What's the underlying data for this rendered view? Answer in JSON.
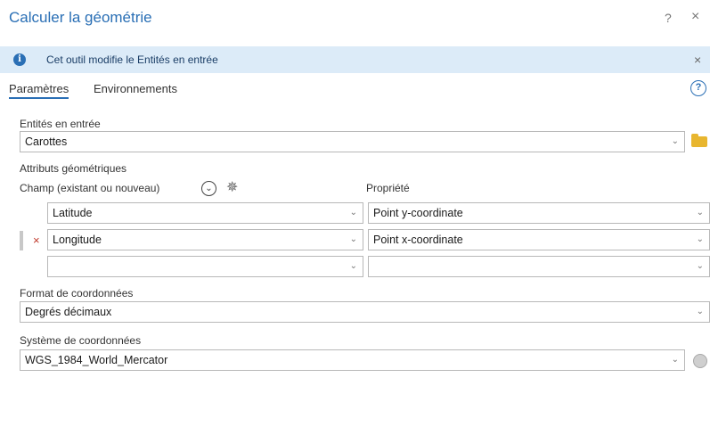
{
  "window": {
    "title": "Calculer la géométrie",
    "help_label": "?",
    "close_label": "×"
  },
  "info": {
    "icon": "info-icon",
    "message": "Cet outil modifie le Entités en entrée",
    "close_label": "×"
  },
  "tabs": [
    {
      "label": "Paramètres",
      "active": true
    },
    {
      "label": "Environnements",
      "active": false
    }
  ],
  "input_features": {
    "label": "Entités en entrée",
    "value": "Carottes"
  },
  "geometry_attributes": {
    "section_label": "Attributs géométriques",
    "field_header": "Champ (existant ou nouveau)",
    "property_header": "Propriété",
    "rows": [
      {
        "field": "Latitude",
        "property": "Point y-coordinate"
      },
      {
        "field": "Longitude",
        "property": "Point x-coordinate"
      },
      {
        "field": "",
        "property": ""
      }
    ]
  },
  "coordinate_format": {
    "label": "Format de coordonnées",
    "value": "Degrés décimaux"
  },
  "coordinate_system": {
    "label": "Système de coordonnées",
    "value": "WGS_1984_World_Mercator"
  },
  "icons": {
    "help": "help-circle-icon",
    "folder": "folder-icon",
    "chevron": "chevron-down-icon",
    "add": "add-field-icon",
    "globe": "globe-icon",
    "remove": "remove-row-icon"
  },
  "colors": {
    "accent": "#2a6fb5",
    "info_bg": "#dcebf8",
    "remove": "#c0392b"
  }
}
